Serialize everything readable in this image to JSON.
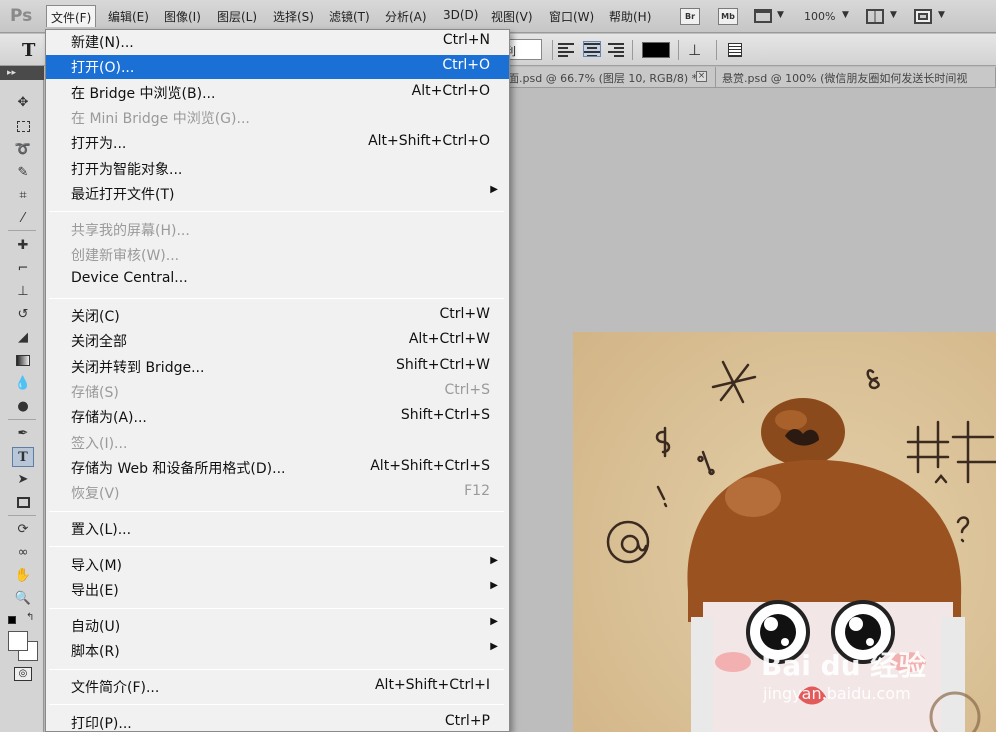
{
  "menubar": {
    "logo": "Ps",
    "items": [
      "文件(F)",
      "编辑(E)",
      "图像(I)",
      "图层(L)",
      "选择(S)",
      "滤镜(T)",
      "分析(A)",
      "3D(D)",
      "视图(V)",
      "窗口(W)",
      "帮助(H)"
    ],
    "bridge_btn": "Br",
    "minibridge_btn": "Mb",
    "zoom": "100%"
  },
  "options": {
    "tool_glyph": "T",
    "aa_combo": "利"
  },
  "tabs": [
    "面.psd @ 66.7% (图层 10, RGB/8) *",
    "悬赏.psd @ 100% (微信朋友圈如何发送长时间视"
  ],
  "toolbar": {
    "collapse_glyph": "▸▸"
  },
  "canvas": {
    "watermark_logo": "Bai du 经验",
    "watermark_url": "jingyan.baidu.com"
  },
  "file_menu": {
    "groups": [
      [
        {
          "label": "新建(N)...",
          "shortcut": "Ctrl+N",
          "enabled": true
        },
        {
          "label": "打开(O)...",
          "shortcut": "Ctrl+O",
          "enabled": true,
          "highlighted": true
        },
        {
          "label": "在 Bridge 中浏览(B)...",
          "shortcut": "Alt+Ctrl+O",
          "enabled": true
        },
        {
          "label": "在 Mini Bridge 中浏览(G)...",
          "shortcut": "",
          "enabled": false
        },
        {
          "label": "打开为...",
          "shortcut": "Alt+Shift+Ctrl+O",
          "enabled": true
        },
        {
          "label": "打开为智能对象...",
          "shortcut": "",
          "enabled": true
        },
        {
          "label": "最近打开文件(T)",
          "shortcut": "",
          "enabled": true,
          "submenu": true
        }
      ],
      [
        {
          "label": "共享我的屏幕(H)...",
          "shortcut": "",
          "enabled": false
        },
        {
          "label": "创建新审核(W)...",
          "shortcut": "",
          "enabled": false
        },
        {
          "label": "Device Central...",
          "shortcut": "",
          "enabled": true
        }
      ],
      [
        {
          "label": "关闭(C)",
          "shortcut": "Ctrl+W",
          "enabled": true
        },
        {
          "label": "关闭全部",
          "shortcut": "Alt+Ctrl+W",
          "enabled": true
        },
        {
          "label": "关闭并转到 Bridge...",
          "shortcut": "Shift+Ctrl+W",
          "enabled": true
        },
        {
          "label": "存储(S)",
          "shortcut": "Ctrl+S",
          "enabled": false
        },
        {
          "label": "存储为(A)...",
          "shortcut": "Shift+Ctrl+S",
          "enabled": true
        },
        {
          "label": "签入(I)...",
          "shortcut": "",
          "enabled": false
        },
        {
          "label": "存储为 Web 和设备所用格式(D)...",
          "shortcut": "Alt+Shift+Ctrl+S",
          "enabled": true
        },
        {
          "label": "恢复(V)",
          "shortcut": "F12",
          "enabled": false
        }
      ],
      [
        {
          "label": "置入(L)...",
          "shortcut": "",
          "enabled": true
        }
      ],
      [
        {
          "label": "导入(M)",
          "shortcut": "",
          "enabled": true,
          "submenu": true
        },
        {
          "label": "导出(E)",
          "shortcut": "",
          "enabled": true,
          "submenu": true
        }
      ],
      [
        {
          "label": "自动(U)",
          "shortcut": "",
          "enabled": true,
          "submenu": true
        },
        {
          "label": "脚本(R)",
          "shortcut": "",
          "enabled": true,
          "submenu": true
        }
      ],
      [
        {
          "label": "文件简介(F)...",
          "shortcut": "Alt+Shift+Ctrl+I",
          "enabled": true
        }
      ],
      [
        {
          "label": "打印(P)...",
          "shortcut": "Ctrl+P",
          "enabled": true
        }
      ]
    ]
  }
}
